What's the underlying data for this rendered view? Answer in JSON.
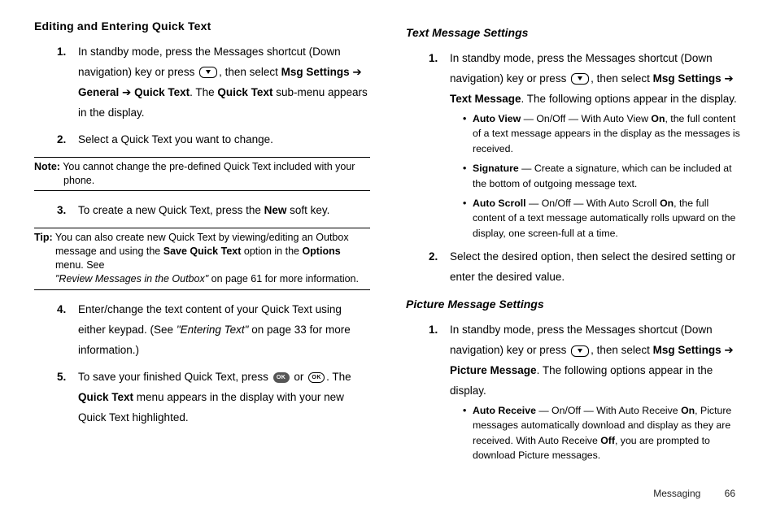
{
  "left": {
    "heading": "Editing and Entering Quick Text",
    "steps": {
      "s1": {
        "num": "1.",
        "pre": "In standby mode, press the Messages shortcut (Down navigation) key or press ",
        "mid1": ", then select ",
        "b1": "Msg Settings",
        "arrow1": " ➔ ",
        "b2": "General",
        "arrow2": " ➔ ",
        "b3": "Quick Text",
        "mid2": ". The ",
        "b4": "Quick Text",
        "tail": " sub-menu appears in the display."
      },
      "s2": {
        "num": "2.",
        "text": "Select a Quick Text you want to change."
      },
      "s3": {
        "num": "3.",
        "pre": "To create a new Quick Text, press the ",
        "b1": "New",
        "tail": " soft key."
      },
      "s4": {
        "num": "4.",
        "pre": "Enter/change the text content of your Quick Text using either keypad. (See ",
        "it": "\"Entering Text\"",
        "tail": " on page 33 for more information.)"
      },
      "s5": {
        "num": "5.",
        "pre": "To save your finished Quick Text, press ",
        "mid": " or ",
        "mid2": ". The ",
        "b1": "Quick Text",
        "tail": " menu appears in the display with your new Quick Text highlighted."
      }
    },
    "note": {
      "label": "Note:",
      "firstline": " You cannot change the pre-defined Quick Text included with your",
      "rest": "phone."
    },
    "tip": {
      "label": "Tip:",
      "firstline": " You can also create new Quick Text by viewing/editing an Outbox",
      "l2a": "message and using the ",
      "l2b": "Save Quick Text",
      "l2c": " option in the ",
      "l2d": "Options",
      "l2e": " menu. See ",
      "l3a": "\"Review Messages in the Outbox\"",
      "l3b": " on page 61 for more information."
    }
  },
  "right": {
    "h_text": "Text Message Settings",
    "text_steps": {
      "s1": {
        "num": "1.",
        "pre": "In standby mode, press the Messages shortcut (Down navigation) key or press ",
        "mid1": ", then select ",
        "b1": "Msg Settings",
        "arrow1": " ➔ ",
        "b2": "Text Message",
        "tail": ". The following options appear in the display."
      },
      "bullets": {
        "b1": {
          "t": "Auto View",
          "a": " — On/Off — With Auto View ",
          "on": "On",
          "b": ", the full content of a text message appears in the display as the messages is received."
        },
        "b2": {
          "t": "Signature",
          "a": " — Create a signature, which can be included at the bottom of outgoing message text."
        },
        "b3": {
          "t": "Auto Scroll",
          "a": " — On/Off — With Auto Scroll ",
          "on": "On",
          "b": ", the full content of a text message automatically rolls upward on the display, one screen-full at a time."
        }
      },
      "s2": {
        "num": "2.",
        "text": "Select the desired option, then select the desired setting or enter the desired value."
      }
    },
    "h_pic": "Picture Message Settings",
    "pic_steps": {
      "s1": {
        "num": "1.",
        "pre": "In standby mode, press the Messages shortcut (Down navigation) key or press ",
        "mid1": ", then select ",
        "b1": "Msg Settings",
        "arrow1": " ➔ ",
        "b2": "Picture Message",
        "tail": ". The following options appear in the display."
      },
      "bullets": {
        "b1": {
          "t": "Auto Receive",
          "a": " — On/Off — With Auto Receive ",
          "on": "On",
          "b": ", Picture messages automatically download and display as they are received. With Auto Receive ",
          "off": "Off",
          "c": ", you are prompted to download Picture messages."
        }
      }
    }
  },
  "footer": {
    "section": "Messaging",
    "page": "66"
  }
}
